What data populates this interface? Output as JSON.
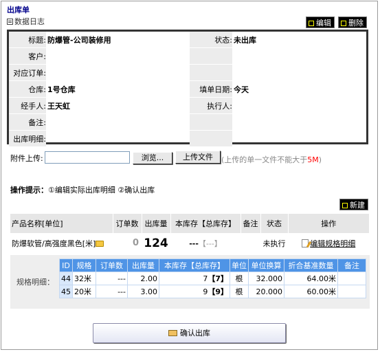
{
  "page": {
    "title": "出库单",
    "log_link": "数据日志",
    "edit_button": "编辑",
    "delete_button": "删除"
  },
  "info": {
    "title_label": "标题:",
    "title_value": "防爆管-公司装修用",
    "status_label": "状态:",
    "status_value": "未出库",
    "customer_label": "客户:",
    "customer_value": "",
    "order_label": "对应订单:",
    "order_value": "",
    "warehouse_label": "仓库:",
    "warehouse_value": "1号仓库",
    "fill_date_label": "填单日期:",
    "fill_date_value": "今天",
    "handler_label": "经手人:",
    "handler_value": "王天虹",
    "executor_label": "执行人:",
    "executor_value": "",
    "remark_label": "备注:",
    "remark_value": "",
    "detail_label": "出库明细:",
    "detail_value": ""
  },
  "upload": {
    "label": "附件上传:",
    "file_value": "",
    "browse_button": "浏览...",
    "upload_button": "上传文件",
    "note_prefix": "(上传的单一文件不能大于",
    "note_size": "5M",
    "note_suffix": ")"
  },
  "hint": {
    "label": "操作提示：",
    "step1": "①编辑实际出库明细",
    "step2": "②确认出库"
  },
  "new_button": "新建",
  "main_table": {
    "headers": [
      "产品名称[单位]",
      "订单数",
      "出库量",
      "本库存【总库存】",
      "备注",
      "状态",
      "操作"
    ],
    "row": {
      "product": "防爆软管/高强度黑色[米]",
      "order_qty": "0",
      "out_qty": "124",
      "stock": "---",
      "stock_total": "【---】",
      "remark": "",
      "status": "未执行",
      "action": "编辑规格明细"
    }
  },
  "spec": {
    "label": "规格明细：",
    "headers": [
      "ID",
      "规格",
      "订单数",
      "出库量",
      "本库存【总库存】",
      "单位",
      "单位换算",
      "折合基准数量",
      "备注"
    ],
    "rows": [
      {
        "id": "44",
        "spec": "32米",
        "order": "---",
        "out": "2.00",
        "stock": "7",
        "total": "【7】",
        "unit": "根",
        "conv": "32.000",
        "base": "64.00米",
        "remark": ""
      },
      {
        "id": "45",
        "spec": "20米",
        "order": "---",
        "out": "3.00",
        "stock": "9",
        "total": "【9】",
        "unit": "根",
        "conv": "20.000",
        "base": "60.00米",
        "remark": ""
      }
    ]
  },
  "confirm_button": "确认出库",
  "colors": {
    "title": "#00008b",
    "spec_header": "#4f94e6",
    "note_red": "#ff0000"
  }
}
